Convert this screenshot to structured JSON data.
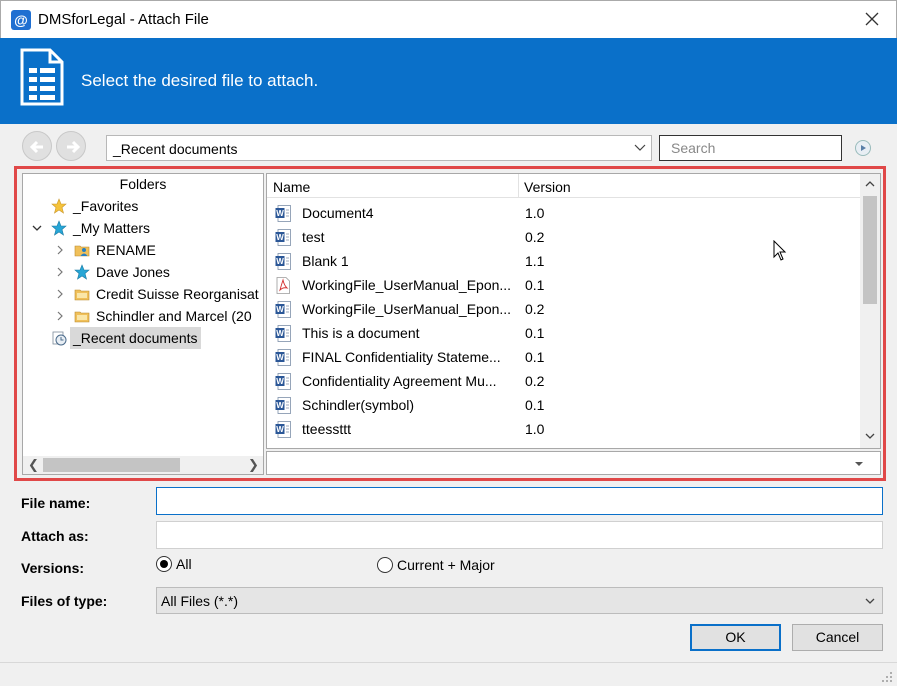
{
  "window": {
    "title": "DMSforLegal - Attach File",
    "app_icon": "@"
  },
  "banner": {
    "text": "Select the desired file to attach.",
    "icon": "document-icon",
    "color": "#0a70c9"
  },
  "toolbar": {
    "location": "_Recent documents",
    "search_placeholder": "Search"
  },
  "tree": {
    "header": "Folders",
    "items": [
      {
        "label": "_Favorites",
        "icon": "star-gold-icon"
      },
      {
        "label": "_My Matters",
        "icon": "star-blue-icon"
      },
      {
        "label": "RENAME",
        "icon": "folder-person-icon"
      },
      {
        "label": "Dave Jones",
        "icon": "star-blue-icon"
      },
      {
        "label": "Credit Suisse Reorganisat",
        "icon": "folder-icon"
      },
      {
        "label": "Schindler and Marcel (20",
        "icon": "folder-icon"
      },
      {
        "label": "_Recent documents",
        "icon": "clock-icon"
      }
    ]
  },
  "list": {
    "columns": {
      "name": "Name",
      "version": "Version"
    },
    "rows": [
      {
        "name": "Document4",
        "version": "1.0",
        "type": "word"
      },
      {
        "name": "test",
        "version": "0.2",
        "type": "word"
      },
      {
        "name": "Blank 1",
        "version": "1.1",
        "type": "word"
      },
      {
        "name": "WorkingFile_UserManual_Epon...",
        "version": "0.1",
        "type": "pdf"
      },
      {
        "name": "WorkingFile_UserManual_Epon...",
        "version": "0.2",
        "type": "word"
      },
      {
        "name": "This is a document",
        "version": "0.1",
        "type": "word"
      },
      {
        "name": "FINAL Confidentiality Stateme...",
        "version": "0.1",
        "type": "word"
      },
      {
        "name": "Confidentiality Agreement Mu...",
        "version": "0.2",
        "type": "word"
      },
      {
        "name": "Schindler(symbol)",
        "version": "0.1",
        "type": "word"
      },
      {
        "name": "tteessttt",
        "version": "1.0",
        "type": "word"
      }
    ]
  },
  "form": {
    "file_name_label": "File name:",
    "file_name_value": "",
    "attach_as_label": "Attach as:",
    "attach_as_value": "",
    "versions_label": "Versions:",
    "versions_all": "All",
    "versions_current_major": "Current + Major",
    "versions_selected": "All",
    "files_of_type_label": "Files of type:",
    "files_of_type_value": "All Files (*.*)"
  },
  "buttons": {
    "ok": "OK",
    "cancel": "Cancel"
  },
  "colors": {
    "accent": "#0a70c9",
    "highlight_border": "#e04848",
    "word_icon": "#2b5797",
    "pdf_icon": "#d32f2f"
  }
}
